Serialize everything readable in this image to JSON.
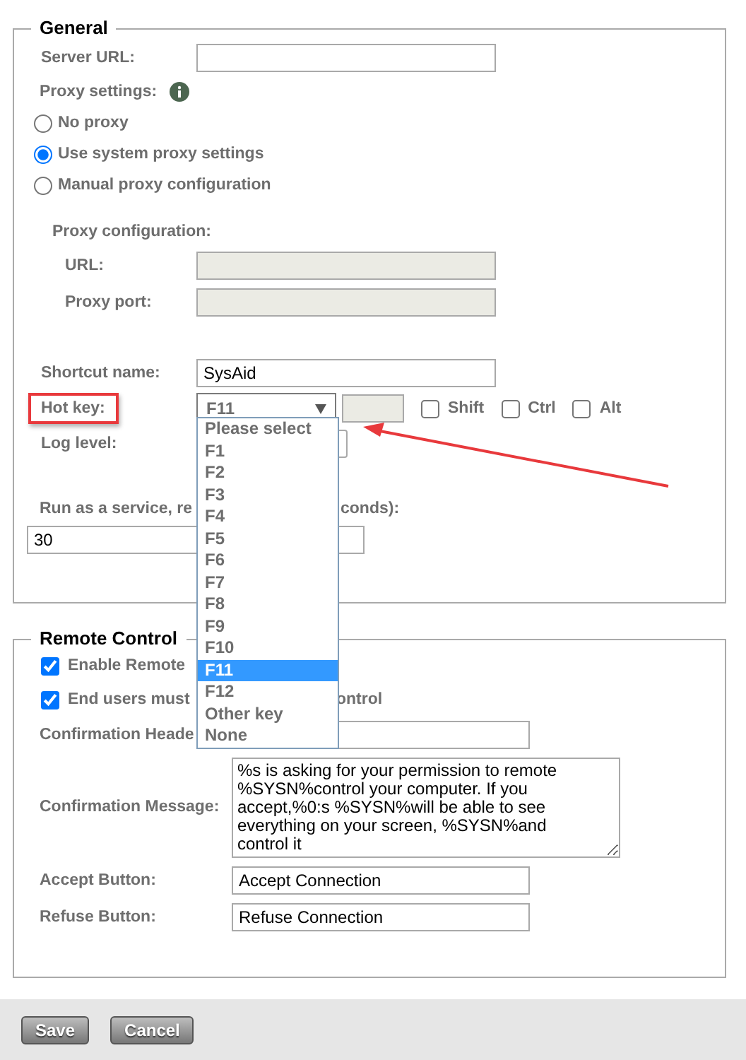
{
  "general": {
    "title": "General",
    "server_url": {
      "label": "Server URL:"
    },
    "proxy_settings": {
      "label": "Proxy settings:",
      "options": [
        {
          "label": "No proxy",
          "selected": false
        },
        {
          "label": "Use system proxy settings",
          "selected": true
        },
        {
          "label": "Manual proxy configuration",
          "selected": false
        }
      ]
    },
    "proxy_configuration": {
      "label": "Proxy configuration:",
      "fields": [
        {
          "label": "URL:",
          "disabled": true
        },
        {
          "label": "Proxy port:",
          "disabled": true
        }
      ]
    },
    "shortcut_name": {
      "label": "Shortcut name:",
      "value": "SysAid"
    },
    "hot_key": {
      "label": "Hot key:",
      "highlighted": true,
      "value": "F11",
      "expanded": true,
      "options": [
        {
          "label": "Please select",
          "selected": false
        },
        {
          "label": "F1",
          "selected": false
        },
        {
          "label": "F2",
          "selected": false
        },
        {
          "label": "F3",
          "selected": false
        },
        {
          "label": "F4",
          "selected": false
        },
        {
          "label": "F5",
          "selected": false
        },
        {
          "label": "F6",
          "selected": false
        },
        {
          "label": "F7",
          "selected": false
        },
        {
          "label": "F8",
          "selected": false
        },
        {
          "label": "F9",
          "selected": false
        },
        {
          "label": "F10",
          "selected": false
        },
        {
          "label": "F11",
          "selected": true
        },
        {
          "label": "F12",
          "selected": false
        },
        {
          "label": "Other key",
          "selected": false
        },
        {
          "label": "None",
          "selected": false
        }
      ],
      "modifiers": [
        {
          "label": "Shift",
          "checked": false
        },
        {
          "label": "Ctrl",
          "checked": false
        },
        {
          "label": "Alt",
          "checked": false
        }
      ]
    },
    "log_level": {
      "label": "Log level:"
    },
    "service": {
      "label_parts": [
        "Run as a service, re",
        "conds):"
      ],
      "value": "30"
    }
  },
  "remote_control": {
    "title": "Remote Control",
    "options": [
      {
        "label_parts": [
          "Enable Remote"
        ],
        "checked": true
      },
      {
        "label_parts": [
          "End users must",
          "ontrol"
        ],
        "checked": true
      }
    ],
    "fields": [
      {
        "kind": "input",
        "label": "Confirmation Heade"
      },
      {
        "kind": "textarea",
        "label": "Confirmation Message:",
        "value": "%s is asking for your permission to remote %SYSN%control your computer. If you accept,%0:s %SYSN%will be able to see everything on your screen, %SYSN%and control it"
      },
      {
        "kind": "input",
        "label": "Accept Button:",
        "value": "Accept Connection"
      },
      {
        "kind": "input",
        "label": "Refuse Button:",
        "value": "Refuse Connection"
      }
    ]
  },
  "buttons": [
    {
      "label": "Save"
    },
    {
      "label": "Cancel"
    }
  ]
}
